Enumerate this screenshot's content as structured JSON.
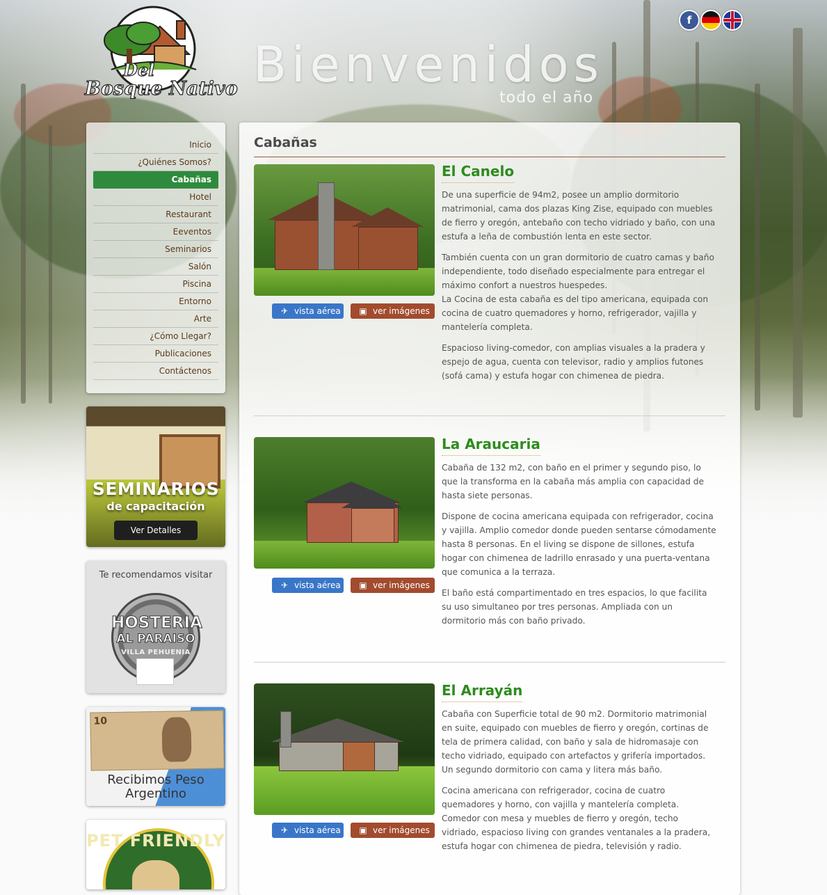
{
  "header": {
    "logo_line1": "Del",
    "logo_line2": "Bosque Nativo",
    "welcome": "Bienvenidos",
    "tagline": "todo el año",
    "social_icon": "facebook-icon",
    "languages": [
      "german-flag-icon",
      "uk-flag-icon"
    ]
  },
  "nav": {
    "items": [
      {
        "label": "Inicio"
      },
      {
        "label": "¿Quiénes Somos?"
      },
      {
        "label": "Cabañas"
      },
      {
        "label": "Hotel"
      },
      {
        "label": "Restaurant"
      },
      {
        "label": "Eeventos"
      },
      {
        "label": "Seminarios"
      },
      {
        "label": "Salón"
      },
      {
        "label": "Piscina"
      },
      {
        "label": "Entorno"
      },
      {
        "label": "Arte"
      },
      {
        "label": "¿Cómo Llegar?"
      },
      {
        "label": "Publicaciones"
      },
      {
        "label": "Contáctenos"
      }
    ],
    "active_index": 2,
    "active_color": "#2e8b3d"
  },
  "ads": {
    "seminarios": {
      "title": "SEMINARIOS",
      "subtitle": "de capacitación",
      "button": "Ver Detalles"
    },
    "hosteria": {
      "heading": "Te recomendamos visitar",
      "line1": "HOSTERIA",
      "line2": "AL PARAISO",
      "line3": "VILLA PEHUENIA"
    },
    "peso": {
      "text_line1": "Recibimos Peso",
      "text_line2": "Argentino",
      "bill_value": "10"
    },
    "pet": {
      "text": "PET FRIENDLY"
    }
  },
  "main": {
    "title": "Cabañas",
    "buttons": {
      "aerial": "vista aérea",
      "images": "ver imágenes",
      "aerial_icon": "airplane-icon",
      "images_icon": "image-icon"
    },
    "cabins": [
      {
        "name": "El Canelo",
        "paragraphs": [
          "De una superficie de 94m2, posee un amplio dormitorio matrimonial, cama dos plazas King Zise, equipado  con  muebles  de  fierro  y oregón, antebaño con techo vidriado y baño, con una estufa a leña de combustión lenta en este sector.",
          "También cuenta con un gran dormitorio de cuatro camas y baño independiente, todo diseñado especialmente para entregar el máximo confort a nuestros huespedes.\nLa Cocina de esta cabaña es del tipo americana,  equipada  con cocina  de  cuatro   quemadores y horno, refrigerador, vajilla y mantelería completa.",
          "Espacioso living-comedor, con amplias visuales a la pradera y espejo de agua, cuenta con televisor, radio y amplios futones (sofá cama) y estufa hogar con chimenea de piedra."
        ]
      },
      {
        "name": "La Araucaria",
        "paragraphs": [
          "Cabaña de 132 m2, con baño en el primer y segundo piso, lo que la transforma en la cabaña más amplia con capacidad de hasta siete personas.",
          "Dispone de cocina americana equipada con refrigerador, cocina y vajilla. Amplio comedor donde pueden sentarse cómodamente hasta 8 personas. En el living se dispone de sillones, estufa hogar con chimenea de ladrillo enrasado y una puerta-ventana que comunica a la terraza.",
          "El baño está compartimentado en tres espacios, lo que facilita su uso simultaneo por tres personas. Ampliada con un dormitorio más con baño privado."
        ]
      },
      {
        "name": "El Arrayán",
        "paragraphs": [
          "Cabaña con Superficie total de 90 m2. Dormitorio matrimonial en suite, equipado con muebles de fierro y oregón, cortinas de tela de primera calidad, con baño y sala de hidromasaje con techo vidriado, equipado con artefactos y grifería importados. Un segundo dormitorio con cama y litera más baño.",
          "Cocina americana con refrigerador, cocina de cuatro quemadores y horno, con vajilla y mantelería completa. Comedor con mesa y muebles de fierro y oregón, techo vidriado, espacioso living con grandes ventanales a la pradera, estufa hogar con chimenea de piedra, televisión y radio."
        ]
      }
    ]
  }
}
